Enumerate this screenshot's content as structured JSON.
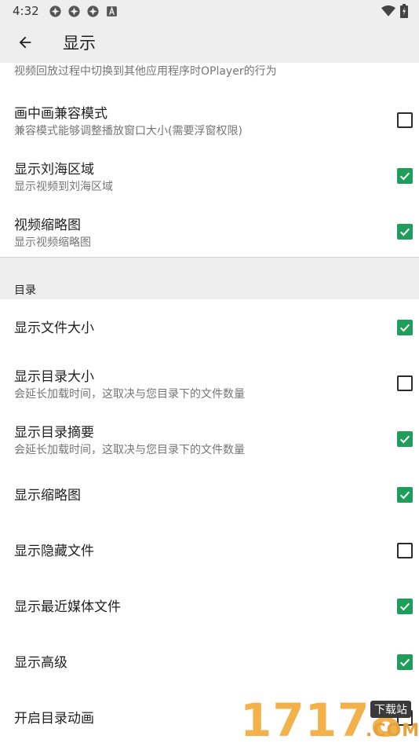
{
  "status": {
    "time": "4:32"
  },
  "appbar": {
    "title": "显示"
  },
  "partial_summary": "视频回放过程中切换到其他应用程序时OPlayer的行为",
  "display_items": [
    {
      "title": "画中画兼容模式",
      "summary": "兼容模式能够调整播放窗口大小(需要浮窗权限)",
      "checked": false
    },
    {
      "title": "显示刘海区域",
      "summary": "显示视频到刘海区域",
      "checked": true
    },
    {
      "title": "视频缩略图",
      "summary": "显示视频缩略图",
      "checked": true
    }
  ],
  "category": {
    "title": "目录"
  },
  "directory_items": [
    {
      "title": "显示文件大小",
      "summary": "",
      "checked": true
    },
    {
      "title": "显示目录大小",
      "summary": "会延长加载时间，这取决与您目录下的文件数量",
      "checked": false
    },
    {
      "title": "显示目录摘要",
      "summary": "会延长加载时间，这取决与您目录下的文件数量",
      "checked": true
    },
    {
      "title": "显示缩略图",
      "summary": "",
      "checked": true
    },
    {
      "title": "显示隐藏文件",
      "summary": "",
      "checked": false
    },
    {
      "title": "显示最近媒体文件",
      "summary": "",
      "checked": true
    },
    {
      "title": "显示高级",
      "summary": "",
      "checked": true
    },
    {
      "title": "开启目录动画",
      "summary": "",
      "checked": false
    }
  ],
  "watermark": {
    "brand": "17178",
    "sub": "下载站",
    "com": ".COM"
  },
  "colors": {
    "accent": "#1e9e5a",
    "appbar": "#eeeeee",
    "watermark": "#f2b14a"
  }
}
